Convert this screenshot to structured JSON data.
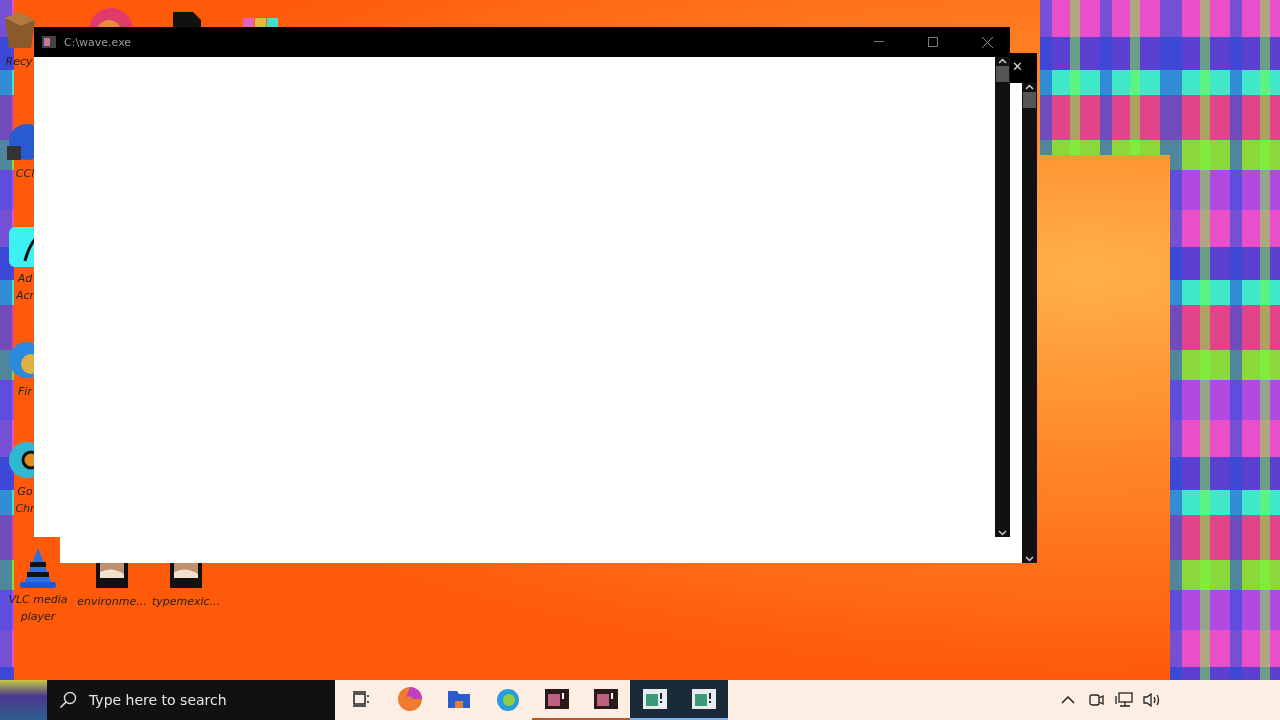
{
  "desktop_icons": [
    {
      "kind": "recycle",
      "lines": [
        "Recy"
      ]
    },
    {
      "kind": "orb"
    },
    {
      "kind": "file"
    },
    {
      "kind": "books"
    },
    {
      "kind": "cleaner",
      "lines": [
        "CCl"
      ]
    },
    {
      "kind": "acrobat",
      "lines": [
        "Ad",
        "Acr"
      ]
    },
    {
      "kind": "firefox",
      "lines": [
        "Fir"
      ]
    },
    {
      "kind": "chrome",
      "lines": [
        "Go",
        "Chr"
      ]
    },
    {
      "kind": "vlc",
      "lines": [
        "VLC media",
        "player"
      ]
    },
    {
      "kind": "image",
      "lines": [
        "environme..."
      ]
    },
    {
      "kind": "image",
      "lines": [
        "typemexic..."
      ]
    }
  ],
  "back_window": {
    "close": "✕"
  },
  "window": {
    "title": "C:\\wave.exe"
  },
  "taskbar": {
    "search": {
      "placeholder": "Type here to search"
    },
    "apps": [
      {
        "kind": "taskview",
        "running": false,
        "selected": false
      },
      {
        "kind": "edge",
        "running": false,
        "selected": false
      },
      {
        "kind": "explorer",
        "running": false,
        "selected": false
      },
      {
        "kind": "firefox",
        "running": false,
        "selected": false
      },
      {
        "kind": "console",
        "running": true,
        "selected": false
      },
      {
        "kind": "console",
        "running": true,
        "selected": false
      },
      {
        "kind": "terminal",
        "running": true,
        "selected": true
      },
      {
        "kind": "terminal",
        "running": true,
        "selected": true
      }
    ],
    "tray": [
      {
        "kind": "chevron"
      },
      {
        "kind": "meet"
      },
      {
        "kind": "network"
      },
      {
        "kind": "volume"
      }
    ]
  }
}
